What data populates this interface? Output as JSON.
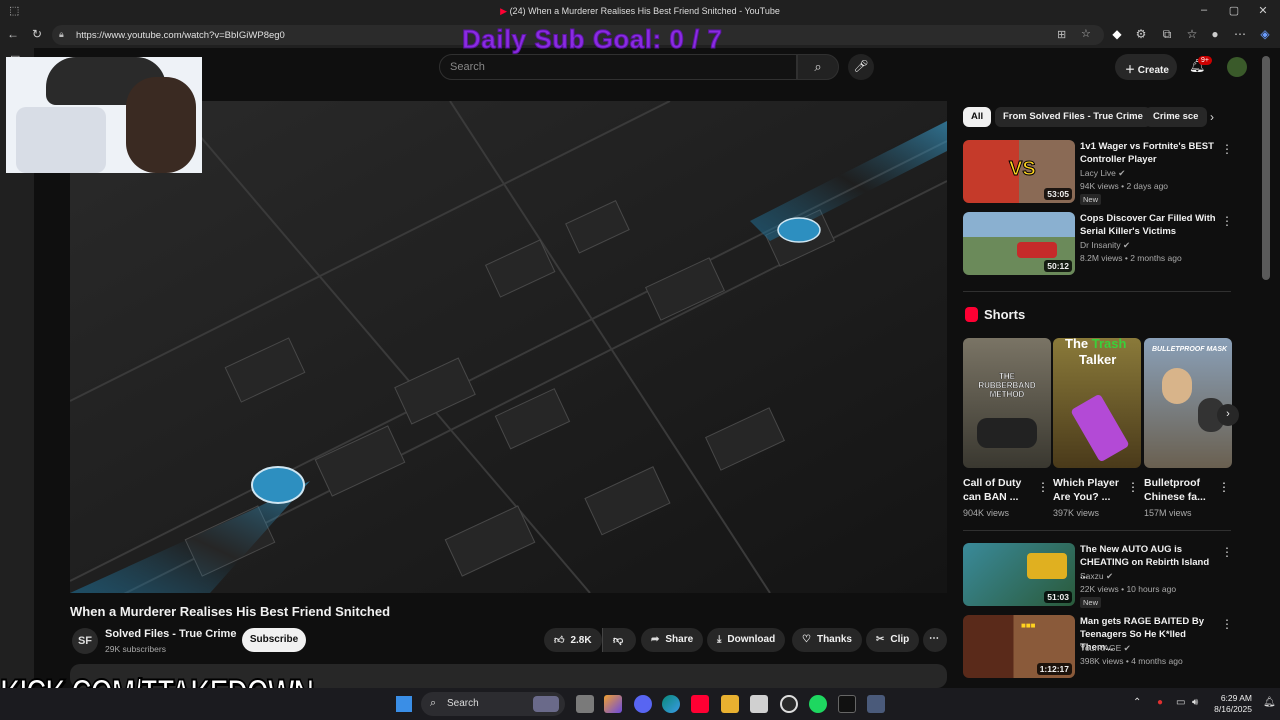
{
  "browser": {
    "tab_title": "(24) When a Murderer Realises His Best Friend Snitched - YouTube",
    "url": "https://www.youtube.com/watch?v=BbIGiWP8eg0"
  },
  "youtube": {
    "search_placeholder": "Search",
    "create_label": "Create",
    "notif_count": "9+"
  },
  "video": {
    "title": "When a Murderer Realises His Best Friend Snitched",
    "channel": "Solved Files - True Crime",
    "channel_logo": "SF",
    "subscribers": "29K subscribers",
    "subscribe_label": "Subscribe",
    "likes": "2.8K",
    "share_label": "Share",
    "download_label": "Download",
    "thanks_label": "Thanks",
    "clip_label": "Clip"
  },
  "chips": [
    {
      "label": "All",
      "active": true
    },
    {
      "label": "From Solved Files - True Crime",
      "active": false
    },
    {
      "label": "Crime sce",
      "active": false
    }
  ],
  "recommended_top": [
    {
      "title": "1v1 Wager vs Fortnite's BEST Controller Player",
      "channel": "Lacy Live",
      "meta": "94K views • 2 days ago",
      "duration": "53:05",
      "badge": "New",
      "thumb_color": "#c53a2a"
    },
    {
      "title": "Cops Discover Car Filled With Serial Killer's Victims",
      "channel": "Dr Insanity",
      "meta": "8.2M views • 2 months ago",
      "duration": "50:12",
      "badge": "",
      "thumb_color": "#6b8a5a"
    }
  ],
  "shorts": {
    "heading": "Shorts",
    "items": [
      {
        "title": "Call of Duty can BAN ...",
        "views": "904K views",
        "overlay": "THE RUBBERBAND METHOD",
        "thumb_color": "#4d4a40"
      },
      {
        "title": "Which Player Are You? ...",
        "views": "397K views",
        "overlay_a": "The",
        "overlay_b": "Trash",
        "overlay_c": "Talker",
        "thumb_color": "#6a5a2a"
      },
      {
        "title": "Bulletproof Chinese fa...",
        "views": "157M views",
        "overlay": "BULLETPROOF MASK",
        "thumb_color": "#5f6a78"
      }
    ]
  },
  "recommended_bottom": [
    {
      "title": "The New AUTO AUG is CHEATING on Rebirth Island ...",
      "channel": "Saxzu",
      "meta": "22K views • 10 hours ago",
      "duration": "51:03",
      "badge": "New",
      "thumb_color": "#3a8a9a"
    },
    {
      "title": "Man gets RAGE BAITED By Teenagers So He K*lled Them...",
      "channel": "YourRAGE",
      "meta": "398K views • 4 months ago",
      "duration": "1:12:17",
      "badge": "",
      "thumb_color": "#7a3a2a"
    }
  ],
  "overlays": {
    "sub_goal": "Daily Sub Goal:  0 / 7",
    "kick": "KICK.COM/TTAKEDOWN"
  },
  "taskbar": {
    "search_label": "Search",
    "time": "6:29 AM",
    "date": "8/16/2025"
  },
  "colors": {
    "yt_bg": "#0f0f0f",
    "pill": "#272727",
    "subgoal": "#8a2be2",
    "brand_red": "#ff0033"
  }
}
